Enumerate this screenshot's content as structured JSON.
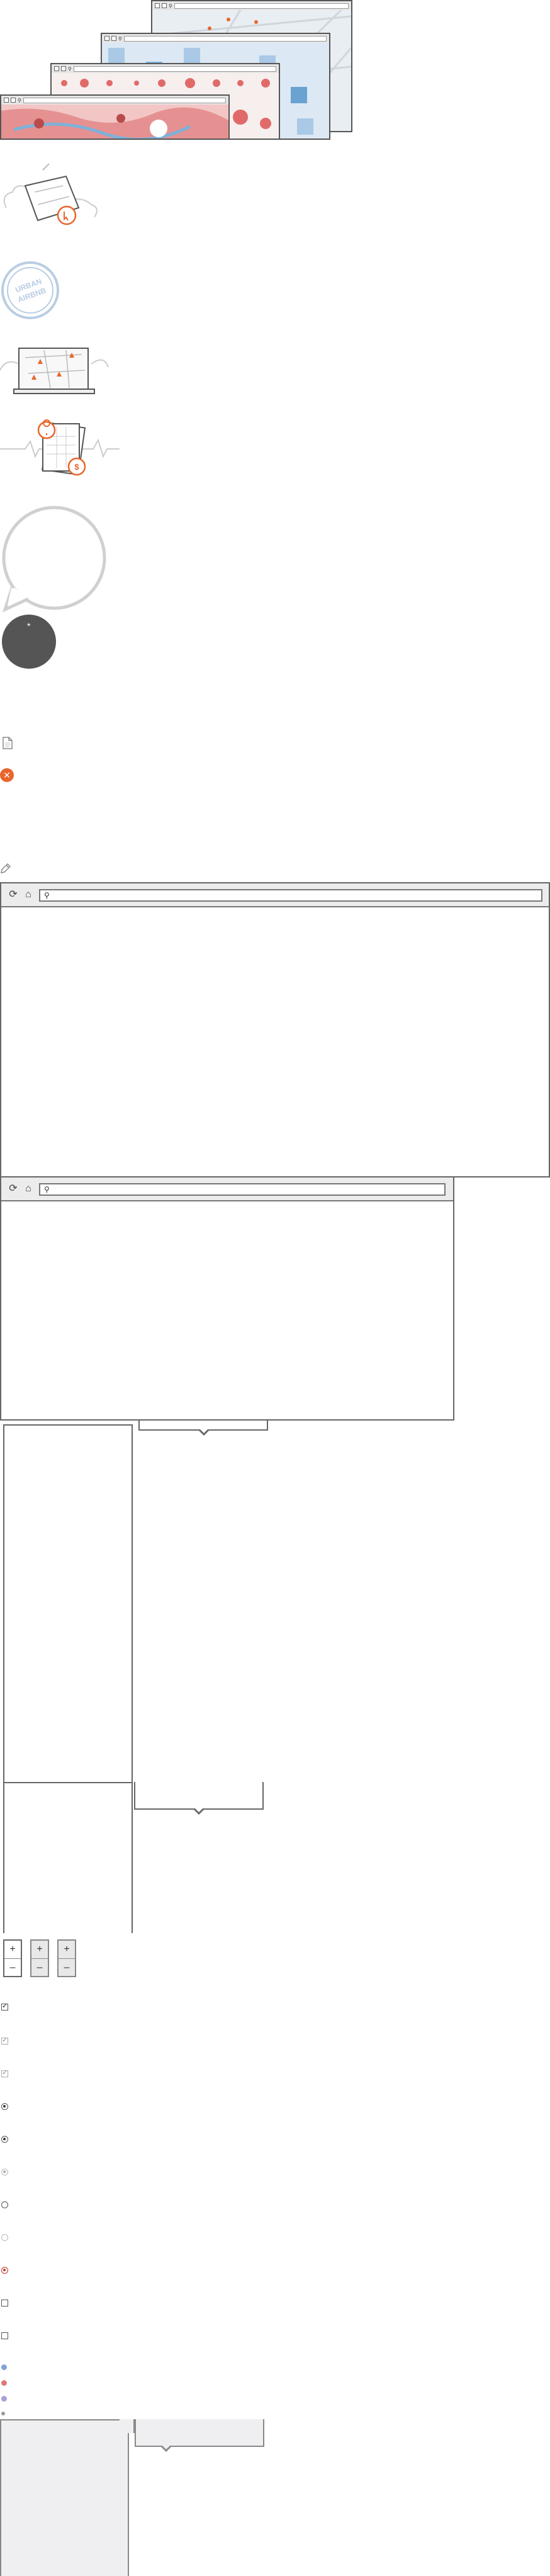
{
  "hero": {
    "windows": [
      "browser-window-back",
      "browser-window-mid-back",
      "browser-window-mid-front",
      "browser-window-front"
    ]
  },
  "illustrations": {
    "stamp_text": [
      "URBAN",
      "AIRBNB"
    ]
  },
  "colors": {
    "accent_orange": "#e8662c",
    "map_blue": "#7fb0d8",
    "map_red": "#e06a6a",
    "dark_circle": "#555555",
    "panel_gray": "#efeff1"
  },
  "icons": {
    "reload": "reload-icon",
    "home": "home-icon",
    "search": "search-icon",
    "close": "close-icon",
    "document": "document-icon",
    "pencil": "pencil-icon"
  },
  "zoom": {
    "plus": "+",
    "minus": "–"
  },
  "dark_circle_label": "*"
}
